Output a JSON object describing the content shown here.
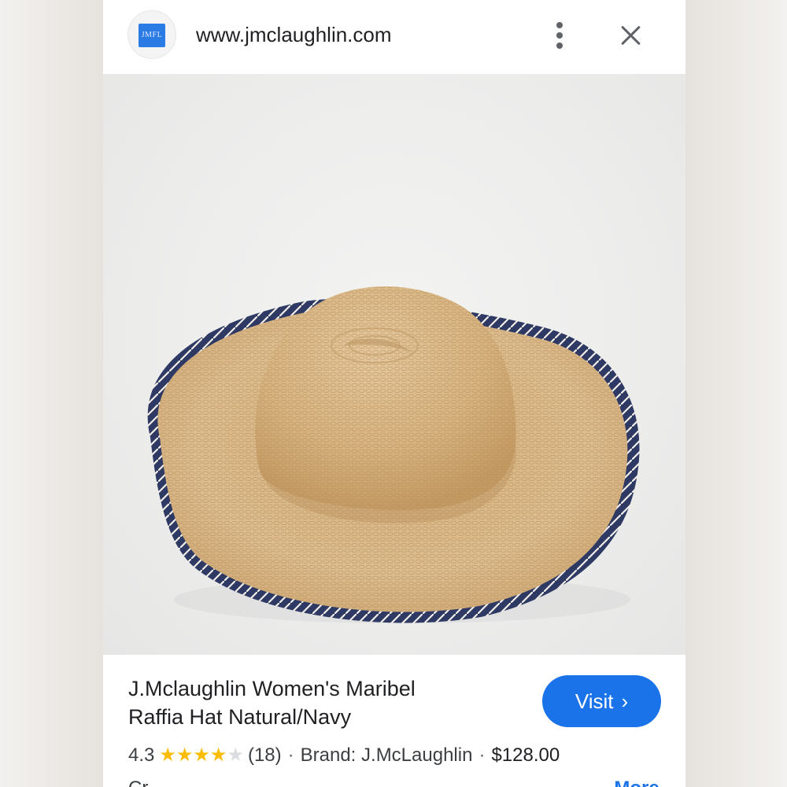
{
  "header": {
    "favicon_text": "JMFL",
    "url": "www.jmclaughlin.com",
    "menu_icon": "more-vert-icon",
    "close_icon": "close-icon"
  },
  "product_image": {
    "alt": "Natural raffia hat with navy trim"
  },
  "product": {
    "title_line1": "J.Mclaughlin Women's Maribel",
    "title_line2": "Raffia Hat Natural/Navy",
    "rating": "4.3",
    "stars_filled": 4,
    "stars_total": 5,
    "review_count": "(18)",
    "separator": "·",
    "brand": "Brand: J.McLaughlin",
    "price": "$128.00",
    "description_partial": "Cr...",
    "more_label": "More"
  },
  "actions": {
    "visit_label": "Visit",
    "visit_chevron": "›"
  },
  "colors": {
    "accent": "#1a73e8",
    "star": "#fbbc04",
    "straw": "#d9b98a",
    "trim": "#2e3a63"
  }
}
